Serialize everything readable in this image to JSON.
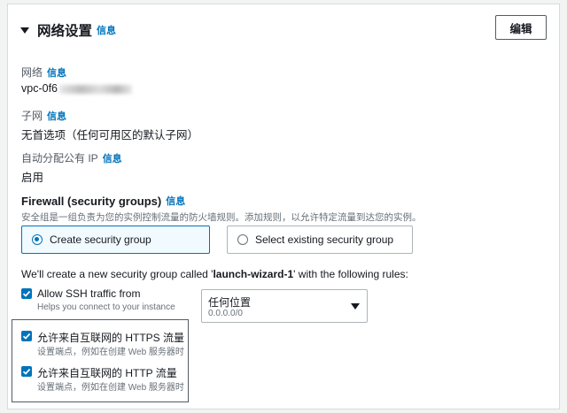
{
  "header": {
    "title": "网络设置",
    "info": "信息",
    "edit_label": "编辑"
  },
  "network": {
    "label": "网络",
    "info": "信息",
    "value": "vpc-0f6"
  },
  "subnet": {
    "label": "子网",
    "info": "信息",
    "value": "无首选项（任何可用区的默认子网）"
  },
  "public_ip": {
    "label": "自动分配公有 IP",
    "info": "信息",
    "value": "启用"
  },
  "firewall": {
    "title": "Firewall (security groups)",
    "info": "信息",
    "description": "安全组是一组负责为您的实例控制流量的防火墙规则。添加规则，以允许特定流量到达您的实例。",
    "options": [
      {
        "label": "Create security group",
        "selected": true
      },
      {
        "label": "Select existing security group",
        "selected": false
      }
    ]
  },
  "rules_intro": {
    "prefix": "We'll create a new security group called '",
    "name": "launch-wizard-1",
    "suffix": "' with the following rules:"
  },
  "rules": [
    {
      "label": "Allow SSH traffic from",
      "sub": "Helps you connect to your instance",
      "checked": true
    },
    {
      "label": "允许来自互联网的 HTTPS 流量",
      "sub": "设置端点，例如在创建 Web 服务器时",
      "checked": true
    },
    {
      "label": "允许来自互联网的 HTTP 流量",
      "sub": "设置端点，例如在创建 Web 服务器时",
      "checked": true
    }
  ],
  "ssh_source": {
    "value": "任何位置",
    "sub": "0.0.0.0/0"
  },
  "colors": {
    "accent": "#0073bb",
    "text": "#16191f",
    "muted": "#687078",
    "border": "#aab7b8"
  }
}
